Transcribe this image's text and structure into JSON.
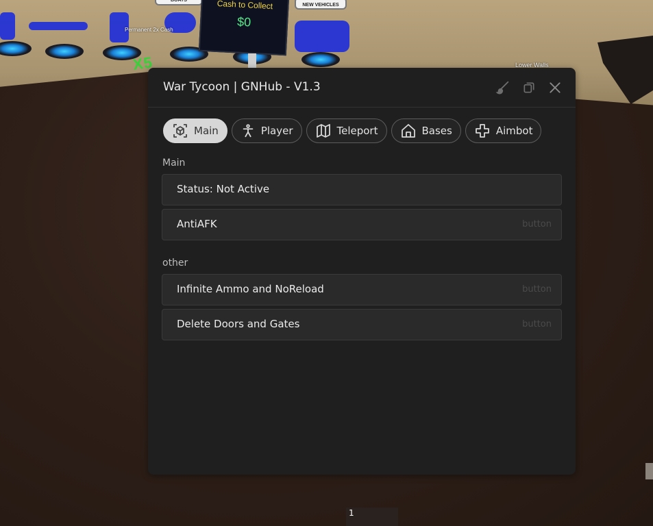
{
  "game": {
    "sign_title": "Cash to Collect",
    "sign_value": "$0",
    "boats_label": "BOATS",
    "new_vehicles_label": "NEW VEHICLES",
    "permanent_cash_label": "Permanent 2x Cash",
    "multiplier_label": "X5",
    "lower_walls_label": "Lower Walls",
    "hotbar_slot": "1"
  },
  "window": {
    "title": "War Tycoon | GNHub - V1.3",
    "actions": [
      "paintbrush-icon",
      "copy-icon",
      "close-icon"
    ]
  },
  "tabs": [
    {
      "label": "Main",
      "icon": "cube-icon",
      "active": true
    },
    {
      "label": "Player",
      "icon": "person-icon",
      "active": false
    },
    {
      "label": "Teleport",
      "icon": "map-icon",
      "active": false
    },
    {
      "label": "Bases",
      "icon": "home-icon",
      "active": false
    },
    {
      "label": "Aimbot",
      "icon": "crosshair-plus-icon",
      "active": false
    }
  ],
  "sections": [
    {
      "label": "Main",
      "rows": [
        {
          "text": "Status: Not Active",
          "hint": ""
        },
        {
          "text": "AntiAFK",
          "hint": "button"
        }
      ]
    },
    {
      "label": "other",
      "rows": [
        {
          "text": "Infinite Ammo and NoReload",
          "hint": "button"
        },
        {
          "text": "Delete Doors and Gates",
          "hint": "button"
        }
      ]
    }
  ],
  "colors": {
    "window_bg": "#1f1f1f",
    "row_bg": "#2a2a2a",
    "active_tab_bg": "#d7d7d7",
    "text": "#ececec"
  }
}
